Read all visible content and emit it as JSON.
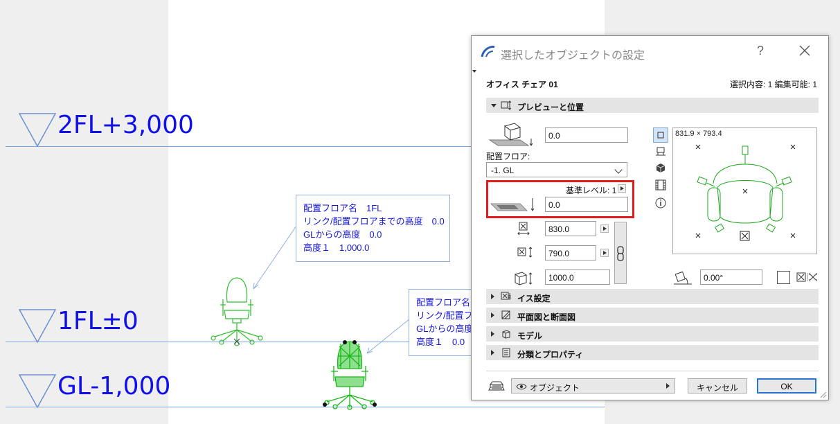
{
  "plan": {
    "levels": [
      {
        "label": "2FL+3,000"
      },
      {
        "label": "1FL±0"
      },
      {
        "label": "GL-1,000"
      }
    ],
    "callout1": {
      "line1": "配置フロア名　1FL",
      "line2": "リンク/配置フロアまでの高度　0.0",
      "line3": "GLからの高度　0.0",
      "line4": "高度１　1,000.0"
    },
    "callout2": {
      "line1": "配置フロア名",
      "line2": "リンク/配置フ",
      "line3": "GLからの高度",
      "line4": "高度１　0.0"
    },
    "colors": {
      "level_text": "#1010e8",
      "chair_green": "#17b817",
      "level_line": "#7aa2dc"
    }
  },
  "dialog": {
    "title": "選択したオブジェクトの設定",
    "help": "?",
    "object_name": "オフィス チェア 01",
    "selection_info": "選択内容: 1 編集可能: 1",
    "preview_section": "プレビューと位置",
    "top_offset": "0.0",
    "floor_label": "配置フロア:",
    "floor_value": "-1. GL",
    "ref_level": "基準レベル: 1",
    "ref_offset": "0.0",
    "width": "830.0",
    "depth": "790.0",
    "height": "1000.0",
    "preview_dims": "831.9 × 793.4",
    "angle": "0.00°",
    "sections": [
      {
        "label": "イス設定"
      },
      {
        "label": "平面図と断面図"
      },
      {
        "label": "モデル"
      },
      {
        "label": "分類とプロパティ"
      }
    ],
    "layer": "オブジェクト",
    "cancel": "キャンセル",
    "ok": "OK",
    "colors": {
      "highlight_box": "#e01c1c",
      "ok_border": "#2a75d0"
    }
  }
}
